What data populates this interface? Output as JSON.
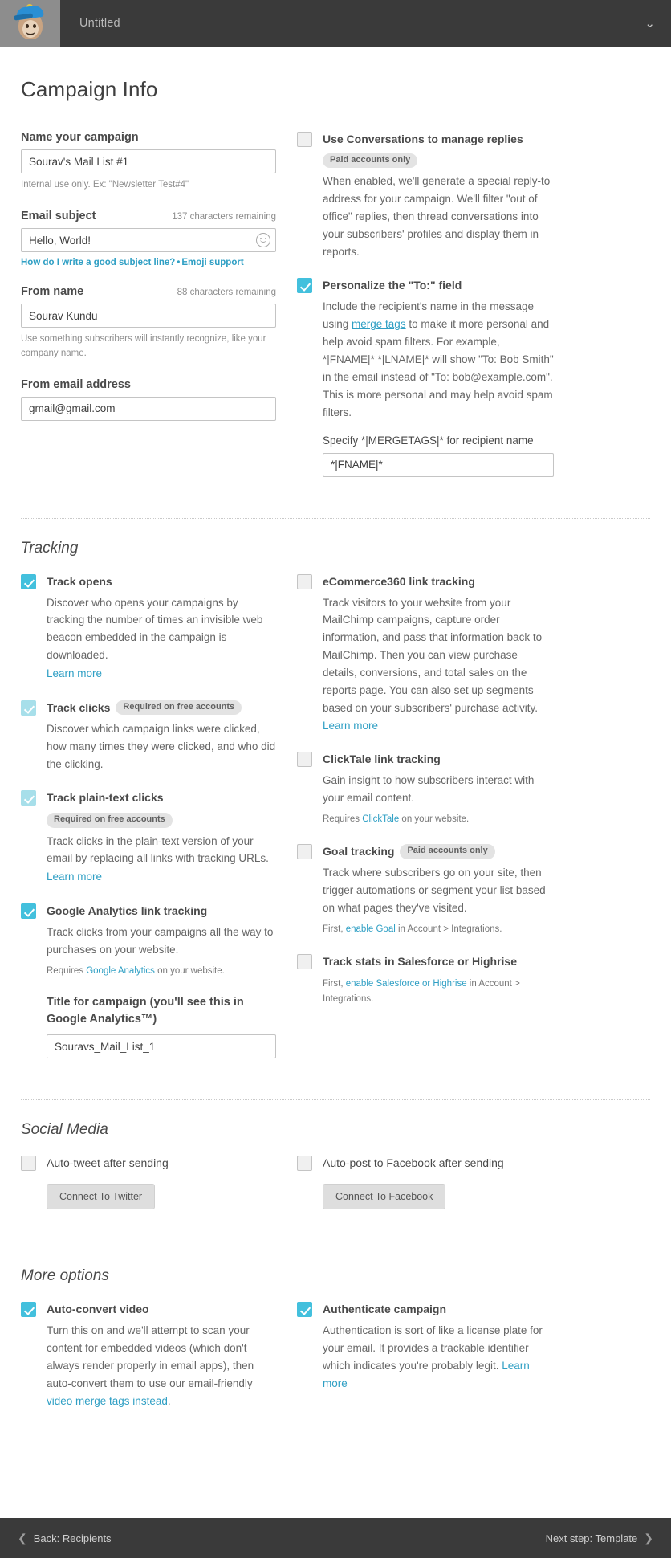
{
  "topbar": {
    "title": "Untitled",
    "caret": "⌄"
  },
  "page_title": "Campaign Info",
  "campaign": {
    "name_label": "Name your campaign",
    "name_value": "Sourav's Mail List #1",
    "name_helper": "Internal use only. Ex: \"Newsletter Test#4\"",
    "subject_label": "Email subject",
    "subject_chars": "137 characters remaining",
    "subject_value": "Hello, World!",
    "subject_link1": "How do I write a good subject line?",
    "subject_sep": "•",
    "subject_link2": "Emoji support",
    "from_name_label": "From name",
    "from_name_chars": "88 characters remaining",
    "from_name_value": "Sourav Kundu",
    "from_name_helper": "Use something subscribers will instantly recognize, like your company name.",
    "from_email_label": "From email address",
    "from_email_value": "gmail@gmail.com"
  },
  "conversations": {
    "title": "Use Conversations to manage replies",
    "badge": "Paid accounts only",
    "desc": "When enabled, we'll generate a special reply-to address for your campaign. We'll filter \"out of office\" replies, then thread conversations into your subscribers' profiles and display them in reports.",
    "checked": false
  },
  "personalize": {
    "title": "Personalize the \"To:\" field",
    "checked": true,
    "desc_1": "Include the recipient's name in the message using ",
    "desc_link": "merge tags",
    "desc_2": " to make it more personal and help avoid spam filters. For example, *|FNAME|* *|LNAME|* will show \"To: Bob Smith\" in the email instead of \"To: bob@example.com\". This is more personal and may help avoid spam filters.",
    "mergetag_label": "Specify *|MERGETAGS|* for recipient name",
    "mergetag_value": "*|FNAME|*"
  },
  "tracking": {
    "heading": "Tracking",
    "left": [
      {
        "name": "track-opens",
        "title": "Track opens",
        "badge": "",
        "checked": true,
        "dim": false,
        "desc": "Discover who opens your campaigns by tracking the number of times an invisible web beacon embedded in the campaign is downloaded.",
        "link": "Learn more"
      },
      {
        "name": "track-clicks",
        "title": "Track clicks",
        "badge": "Required on free accounts",
        "checked": true,
        "dim": true,
        "desc": "Discover which campaign links were clicked, how many times they were clicked, and who did the clicking.",
        "link": ""
      },
      {
        "name": "track-plain-text-clicks",
        "title": "Track plain-text clicks",
        "badge": "Required on free accounts",
        "checked": true,
        "dim": true,
        "desc": "Track clicks in the plain-text version of your email by replacing all links with tracking URLs.",
        "link": "Learn more"
      }
    ],
    "google_analytics": {
      "title": "Google Analytics link tracking",
      "checked": true,
      "desc": "Track clicks from your campaigns all the way to purchases on your website.",
      "requires_prefix": "Requires ",
      "requires_link": "Google Analytics",
      "requires_suffix": " on your website.",
      "field_label": "Title for campaign (you'll see this in Google Analytics™)",
      "field_value": "Souravs_Mail_List_1"
    },
    "right": [
      {
        "name": "ecommerce360",
        "title": "eCommerce360 link tracking",
        "badge": "",
        "checked": false,
        "desc": "Track visitors to your website from your MailChimp campaigns, capture order information, and pass that information back to MailChimp. Then you can view purchase details, conversions, and total sales on the reports page. You can also set up segments based on your subscribers' purchase activity. ",
        "trailing_link": "Learn more",
        "small_prefix": "",
        "small_link": "",
        "small_suffix": ""
      },
      {
        "name": "clicktale",
        "title": "ClickTale link tracking",
        "badge": "",
        "checked": false,
        "desc": "Gain insight to how subscribers interact with your email content.",
        "trailing_link": "",
        "small_prefix": "Requires ",
        "small_link": "ClickTale",
        "small_suffix": " on your website."
      },
      {
        "name": "goal-tracking",
        "title": "Goal tracking",
        "badge": "Paid accounts only",
        "checked": false,
        "desc": "Track where subscribers go on your site, then trigger automations or segment your list based on what pages they've visited.",
        "trailing_link": "",
        "small_prefix": "First, ",
        "small_link": "enable Goal",
        "small_suffix": " in Account > Integrations."
      },
      {
        "name": "salesforce-highrise",
        "title": "Track stats in Salesforce or Highrise",
        "badge": "",
        "checked": false,
        "desc": "",
        "trailing_link": "",
        "small_prefix": "First, ",
        "small_link": "enable Salesforce or Highrise",
        "small_suffix": " in Account > Integrations."
      }
    ]
  },
  "social": {
    "heading": "Social Media",
    "twitter": {
      "title": "Auto-tweet after sending",
      "checked": false,
      "button": "Connect To Twitter"
    },
    "facebook": {
      "title": "Auto-post to Facebook after sending",
      "checked": false,
      "button": "Connect To Facebook"
    }
  },
  "more_options": {
    "heading": "More options",
    "auto_convert": {
      "title": "Auto-convert video",
      "checked": true,
      "desc_1": "Turn this on and we'll attempt to scan your content for embedded videos (which don't always render properly in email apps), then auto-convert them to use our email-friendly ",
      "desc_link": "video merge tags instead",
      "desc_2": "."
    },
    "authenticate": {
      "title": "Authenticate campaign",
      "checked": true,
      "desc_1": "Authentication is sort of like a license plate for your email. It provides a trackable identifier which indicates you're probably legit. ",
      "desc_link": "Learn more"
    }
  },
  "footer": {
    "back_chevron": "❮",
    "back_label": "Back: Recipients",
    "next_label": "Next step: Template",
    "next_chevron": "❯"
  }
}
